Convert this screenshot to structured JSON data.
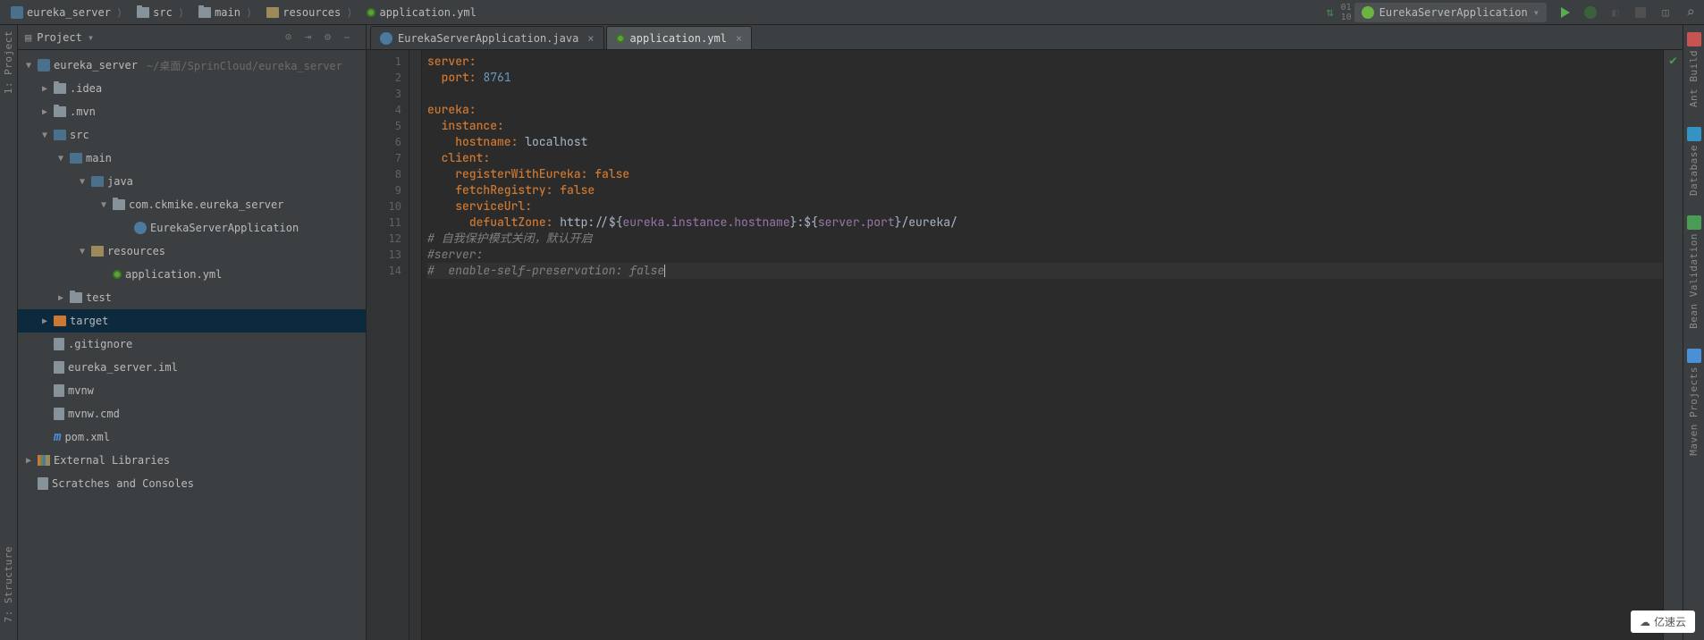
{
  "breadcrumbs": [
    {
      "label": "eureka_server",
      "icon": "module"
    },
    {
      "label": "src",
      "icon": "folder"
    },
    {
      "label": "main",
      "icon": "folder"
    },
    {
      "label": "resources",
      "icon": "res"
    },
    {
      "label": "application.yml",
      "icon": "yml"
    }
  ],
  "runConfig": {
    "label": "EurekaServerApplication"
  },
  "projectPanel": {
    "title": "Project"
  },
  "tree": [
    {
      "indent": 0,
      "arrow": "▼",
      "icon": "module",
      "label": "eureka_server",
      "muted": "~/桌面/SprinCloud/eureka_server"
    },
    {
      "indent": 1,
      "arrow": "▶",
      "icon": "folder",
      "label": ".idea"
    },
    {
      "indent": 1,
      "arrow": "▶",
      "icon": "folder",
      "label": ".mvn"
    },
    {
      "indent": 1,
      "arrow": "▼",
      "icon": "src",
      "label": "src"
    },
    {
      "indent": 2,
      "arrow": "▼",
      "icon": "src",
      "label": "main"
    },
    {
      "indent": 3,
      "arrow": "▼",
      "icon": "src",
      "label": "java"
    },
    {
      "indent": 4,
      "arrow": "▼",
      "icon": "pkg",
      "label": "com.ckmike.eureka_server"
    },
    {
      "indent": 5,
      "arrow": "",
      "icon": "class",
      "label": "EurekaServerApplication"
    },
    {
      "indent": 3,
      "arrow": "▼",
      "icon": "res",
      "label": "resources"
    },
    {
      "indent": 4,
      "arrow": "",
      "icon": "yml",
      "label": "application.yml"
    },
    {
      "indent": 2,
      "arrow": "▶",
      "icon": "folder",
      "label": "test"
    },
    {
      "indent": 1,
      "arrow": "▶",
      "icon": "target",
      "label": "target",
      "selected": true
    },
    {
      "indent": 1,
      "arrow": "",
      "icon": "file",
      "label": ".gitignore"
    },
    {
      "indent": 1,
      "arrow": "",
      "icon": "file",
      "label": "eureka_server.iml"
    },
    {
      "indent": 1,
      "arrow": "",
      "icon": "file",
      "label": "mvnw"
    },
    {
      "indent": 1,
      "arrow": "",
      "icon": "file",
      "label": "mvnw.cmd"
    },
    {
      "indent": 1,
      "arrow": "",
      "icon": "m",
      "label": "pom.xml"
    },
    {
      "indent": 0,
      "arrow": "▶",
      "icon": "lib",
      "label": "External Libraries"
    },
    {
      "indent": 0,
      "arrow": "",
      "icon": "file",
      "label": "Scratches and Consoles"
    }
  ],
  "tabs": [
    {
      "label": "EurekaServerApplication.java",
      "icon": "class",
      "active": false
    },
    {
      "label": "application.yml",
      "icon": "yml",
      "active": true
    }
  ],
  "codeLines": [
    {
      "n": 1,
      "html": "<span class='k'>server:</span>"
    },
    {
      "n": 2,
      "html": "  <span class='k'>port:</span> <span class='n'>8761</span>"
    },
    {
      "n": 3,
      "html": ""
    },
    {
      "n": 4,
      "html": "<span class='k'>eureka:</span>"
    },
    {
      "n": 5,
      "html": "  <span class='k'>instance:</span>"
    },
    {
      "n": 6,
      "html": "    <span class='k'>hostname:</span> <span class='v'>localhost</span>"
    },
    {
      "n": 7,
      "html": "  <span class='k'>client:</span>"
    },
    {
      "n": 8,
      "html": "    <span class='k'>registerWithEureka:</span> <span class='k'>false</span>"
    },
    {
      "n": 9,
      "html": "    <span class='k'>fetchRegistry:</span> <span class='k'>false</span>"
    },
    {
      "n": 10,
      "html": "    <span class='k'>serviceUrl:</span>"
    },
    {
      "n": 11,
      "html": "      <span class='k'>defualtZone:</span> <span class='v'>http://${</span><span class='prop'>eureka.instance.hostname</span><span class='v'>}:${</span><span class='prop'>server.port</span><span class='v'>}/eureka/</span>"
    },
    {
      "n": 12,
      "html": "<span class='c'># 自我保护模式关闭，默认开启</span>"
    },
    {
      "n": 13,
      "html": "<span class='c'>#server:</span>"
    },
    {
      "n": 14,
      "html": "<span class='c'>#  enable-self-preservation: false</span><span class='caret'></span>",
      "current": true
    }
  ],
  "leftTools": [
    {
      "label": "1: Project"
    },
    {
      "label": "7: Structure"
    }
  ],
  "rightTools": [
    {
      "label": "Ant Build",
      "color": "#c75450"
    },
    {
      "label": "Database",
      "color": "#3592c4"
    },
    {
      "label": "Bean Validation",
      "color": "#499c54"
    },
    {
      "label": "Maven Projects",
      "color": "#4a90d9"
    }
  ],
  "watermark": "亿速云"
}
